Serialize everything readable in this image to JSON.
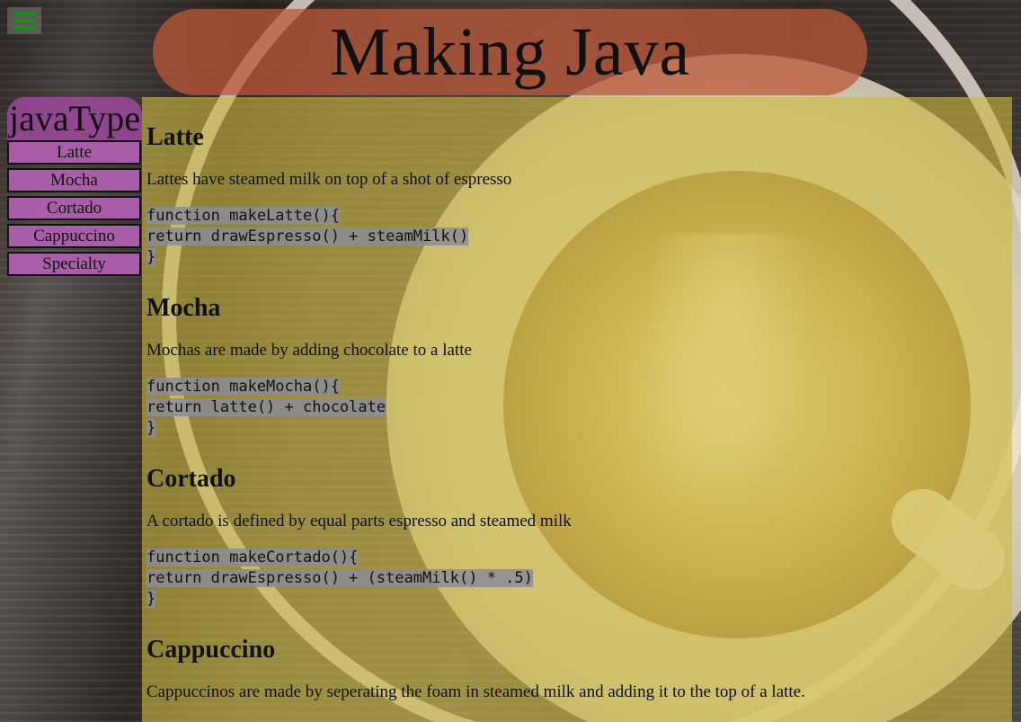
{
  "header": {
    "title": "Making Java"
  },
  "nav": {
    "title": "javaType",
    "items": [
      "Latte",
      "Mocha",
      "Cortado",
      "Cappuccino",
      "Specialty"
    ]
  },
  "sections": [
    {
      "heading": "Latte",
      "description": "Lattes have steamed milk on top of a shot of espresso",
      "code": [
        "function makeLatte(){",
        "return drawEspresso() + steamMilk()",
        "}"
      ]
    },
    {
      "heading": "Mocha",
      "description": "Mochas are made by adding chocolate to a latte",
      "code": [
        "function makeMocha(){",
        "return latte() + chocolate",
        "}"
      ]
    },
    {
      "heading": "Cortado",
      "description": "A cortado is defined by equal parts espresso and steamed milk",
      "code": [
        "function makeCortado(){",
        "return drawEspresso() + (steamMilk() * .5)",
        "}"
      ]
    },
    {
      "heading": "Cappuccino",
      "description": "Cappuccinos are made by seperating the foam in steamed milk and adding it to the top of a latte."
    }
  ],
  "colors": {
    "menu_icon": "#1a8d1a",
    "title_pill": "#be583a",
    "nav": "#b260b2",
    "main_panel": "#ccb940"
  },
  "icons": {
    "menu": "hamburger-menu-icon"
  }
}
